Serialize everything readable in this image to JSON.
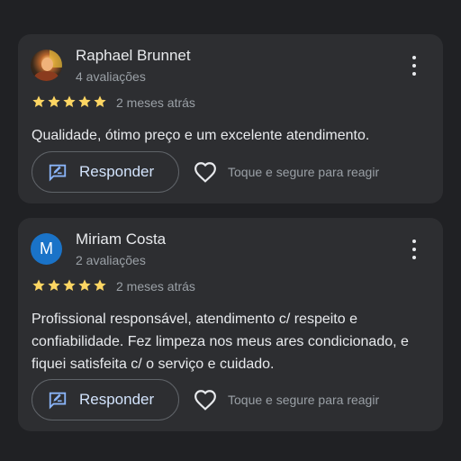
{
  "colors": {
    "background": "#202124",
    "card": "#2d2e31",
    "star": "#fdd663",
    "accent": "#8ab4f8",
    "avatar_blue": "#1a73c8"
  },
  "icons": {
    "star": "star-icon",
    "more": "more-vert-icon",
    "respond": "rate-review-icon",
    "react": "heart-outline-icon"
  },
  "reviews": [
    {
      "name": "Raphael Brunnet",
      "count": "4 avaliações",
      "rating": 5,
      "time": "2 meses atrás",
      "text": "Qualidade, ótimo preço e um excelente atendimento.",
      "respond_label": "Responder",
      "react_hint": "Toque e segure para reagir"
    },
    {
      "name": "Miriam Costa",
      "avatar_letter": "M",
      "count": "2 avaliações",
      "rating": 5,
      "time": "2 meses atrás",
      "text": "Profissional responsável, atendimento c/ respeito e confiabilidade. Fez limpeza nos meus ares condicionado, e fiquei satisfeita c/ o serviço e cuidado.",
      "respond_label": "Responder",
      "react_hint": "Toque e segure para reagir"
    }
  ]
}
